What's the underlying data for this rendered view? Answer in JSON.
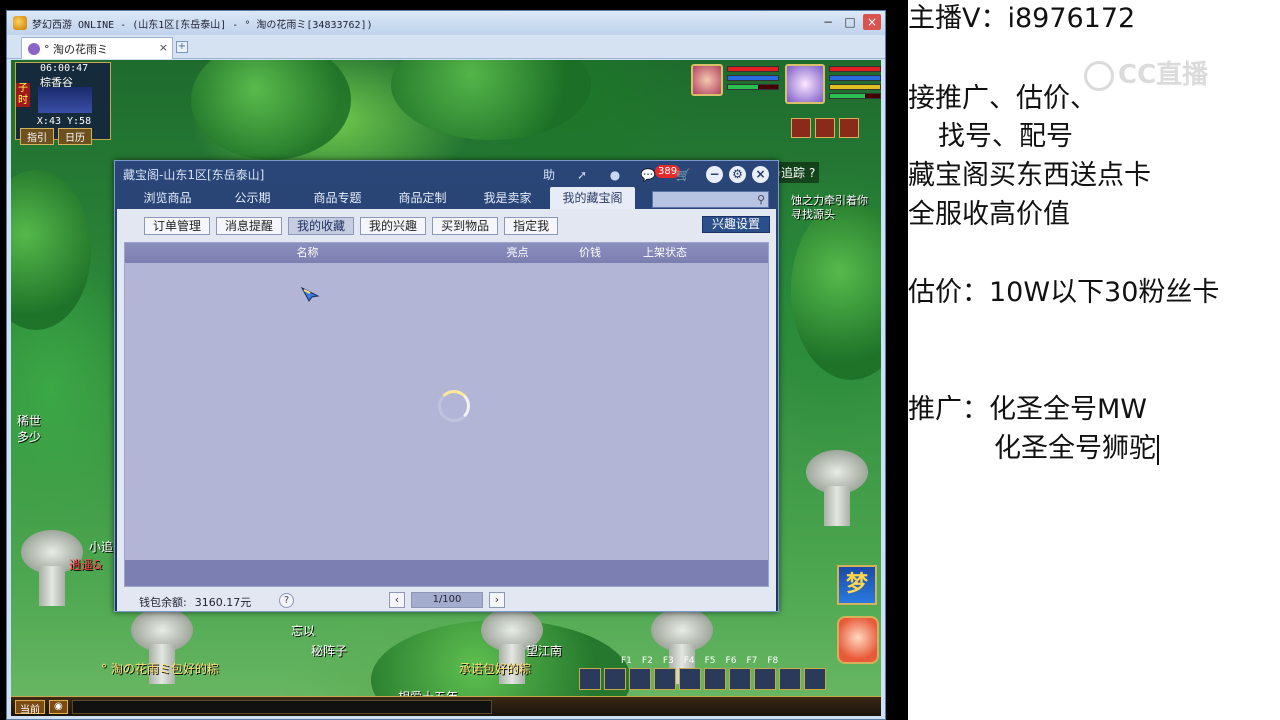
{
  "window": {
    "title": "梦幻西游 ONLINE - (山东1区[东岳泰山] - ° 淘の花雨ミ[34833762])",
    "tab_label": "° 淘の花雨ミ",
    "tab_close": "×",
    "new_tab": "+"
  },
  "hud": {
    "time": "06:00:47",
    "location": "棕香谷",
    "shichen": "子时",
    "coords": "X:43  Y:58",
    "btn_guide": "指引",
    "btn_calendar": "日历",
    "task_track": "任务追踪",
    "task_help": "?",
    "task_text_1": "蚀之力牵引着你",
    "task_text_2": "寻找源头",
    "hotkeys": [
      "F1",
      "F2",
      "F3",
      "F4",
      "F5",
      "F6",
      "F7",
      "F8"
    ],
    "bottom_btn": "当前",
    "dream_logo": "梦"
  },
  "scene_labels": {
    "left_1": "稀世",
    "left_2": "多少",
    "left_3": "小追",
    "left_4": "逍遥&",
    "chat_1": "° 淘の花雨ミ包好的粽",
    "chat_2": "承诺包好的粽",
    "npc_1": "秘阵子",
    "npc_2": "望江南",
    "npc_3": "相爱十五年",
    "npc_4": "忘以"
  },
  "dialog": {
    "title": "藏宝阁-山东1区[东岳泰山]",
    "help": "助",
    "cart_badge": "389",
    "minimize": "−",
    "settings": "⚙",
    "close": "×",
    "nav_tabs": [
      "浏览商品",
      "公示期",
      "商品专题",
      "商品定制",
      "我是卖家",
      "我的藏宝阁"
    ],
    "active_nav": 5,
    "search_placeholder": "",
    "sub_tabs": [
      "订单管理",
      "消息提醒",
      "我的收藏",
      "我的兴趣",
      "买到物品",
      "指定我"
    ],
    "active_sub": 2,
    "interest_settings": "兴趣设置",
    "columns": [
      "名称",
      "亮点",
      "价钱",
      "上架状态"
    ],
    "wallet_label": "钱包余额:",
    "wallet_value": "3160.17元",
    "help_q": "?",
    "page_prev": "‹",
    "page": "1/100",
    "page_next": "›"
  },
  "overlay": {
    "line1": "主播V：i8976172",
    "line2": "接推广、估价、",
    "line3": "找号、配号",
    "line4": "藏宝阁买东西送点卡",
    "line5": "全服收高价值",
    "line6": "估价：10W以下30粉丝卡",
    "line7": "推广：化圣全号MW",
    "line8": "化圣全号狮驼",
    "watermark": "CC直播"
  },
  "colors": {
    "dialog_bg": "#1f3660",
    "table_bg": "#b2b5d6",
    "badge": "#e32b2b"
  }
}
